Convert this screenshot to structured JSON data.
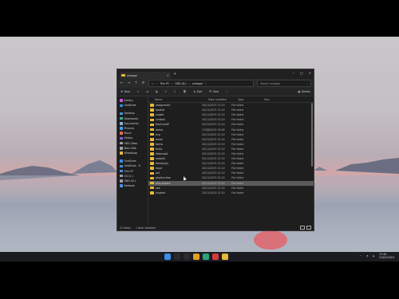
{
  "window": {
    "tab_title": "onlappe",
    "breadcrumb": [
      "This PC",
      "HDD (D:)",
      "onlappe"
    ],
    "search_placeholder": "Search onlappe",
    "commands": {
      "new": "New",
      "sort": "Sort",
      "view": "View",
      "details": "Details"
    }
  },
  "sidebar": {
    "items": [
      {
        "label": "Gallery",
        "color": "#c15ad8"
      },
      {
        "label": "OneDrive",
        "color": "#3b8de0"
      },
      {
        "label": "",
        "color": "#000000"
      },
      {
        "label": "Desktop",
        "color": "#4a8fe8"
      },
      {
        "label": "Downloads",
        "color": "#3fb0a0"
      },
      {
        "label": "Documents",
        "color": "#8ab0d8"
      },
      {
        "label": "Pictures",
        "color": "#48a0e8"
      },
      {
        "label": "Music",
        "color": "#e86a5a"
      },
      {
        "label": "Videos",
        "color": "#8a5ae8"
      },
      {
        "label": "HDD (New",
        "color": "#9aa0a8"
      },
      {
        "label": "Main Disk",
        "color": "#9aa0a8"
      },
      {
        "label": "WhatsApp",
        "color": "#e8b83a"
      },
      {
        "label": "",
        "color": "#000000"
      },
      {
        "label": "OneDrive",
        "color": "#3b8de0"
      },
      {
        "label": "OneDrive - R",
        "color": "#3b8de0"
      },
      {
        "label": "This PC",
        "color": "#4a8fe8"
      },
      {
        "label": "OS (C:)",
        "color": "#9aa0a8"
      },
      {
        "label": "HDD (D:)",
        "color": "#9aa0a8"
      },
      {
        "label": "Network",
        "color": "#4a8fe8"
      }
    ]
  },
  "columns": {
    "name": "Name",
    "date": "Date modified",
    "type": "Type",
    "size": "Size"
  },
  "files": [
    {
      "name": "assignment",
      "date": "20/11/2023 12:10",
      "type": "File folder"
    },
    {
      "name": "bootstr",
      "date": "20/11/2023 12:10",
      "type": "File folder"
    },
    {
      "name": "cookie",
      "date": "20/11/2023 12:10",
      "type": "File folder"
    },
    {
      "name": "contact",
      "date": "20/11/2023 12:10",
      "type": "File folder"
    },
    {
      "name": "DayOneUP",
      "date": "20/11/2023 12:10",
      "type": "File folder"
    },
    {
      "name": "demo",
      "date": "17/08/2023 19:06",
      "type": "File folder"
    },
    {
      "name": "ecp",
      "date": "20/11/2023 12:10",
      "type": "File folder"
    },
    {
      "name": "email",
      "date": "20/11/2023 12:10",
      "type": "File folder"
    },
    {
      "name": "forms",
      "date": "20/11/2023 12:10",
      "type": "File folder"
    },
    {
      "name": "fruits",
      "date": "20/11/2023 12:10",
      "type": "File folder"
    },
    {
      "name": "htdocsjsd",
      "date": "20/11/2023 12:10",
      "type": "File folder"
    },
    {
      "name": "mobilel",
      "date": "20/11/2023 12:10",
      "type": "File folder"
    },
    {
      "name": "htmlphpjs",
      "date": "20/11/2023 12:10",
      "type": "File folder"
    },
    {
      "name": "input",
      "date": "20/11/2023 12:10",
      "type": "File folder"
    },
    {
      "name": "pet",
      "date": "20/11/2023 12:10",
      "type": "File folder"
    },
    {
      "name": "phpfunction",
      "date": "20/11/2023 12:10",
      "type": "File folder"
    },
    {
      "name": "php-project",
      "date": "20/11/2023 12:10",
      "type": "File folder"
    },
    {
      "name": "site",
      "date": "20/11/2023 12:10",
      "type": "File folder"
    },
    {
      "name": "student",
      "date": "20/11/2023 12:10",
      "type": "File folder"
    }
  ],
  "selected_index": 16,
  "status": {
    "count": "21 items",
    "selected": "1 item selected"
  },
  "taskbar": {
    "icons": [
      {
        "name": "windows-start-icon",
        "color": "#3a8ee6"
      },
      {
        "name": "search-icon",
        "color": "#2a2a2a"
      },
      {
        "name": "task-view-icon",
        "color": "#2a2a2a"
      },
      {
        "name": "chrome-icon",
        "color": "#e0a020"
      },
      {
        "name": "edge-icon",
        "color": "#2aa37a"
      },
      {
        "name": "app-red-icon",
        "color": "#d83a3a"
      },
      {
        "name": "file-explorer-icon",
        "color": "#e8b83a"
      }
    ],
    "time": "17:40",
    "date": "21/03/2024"
  }
}
